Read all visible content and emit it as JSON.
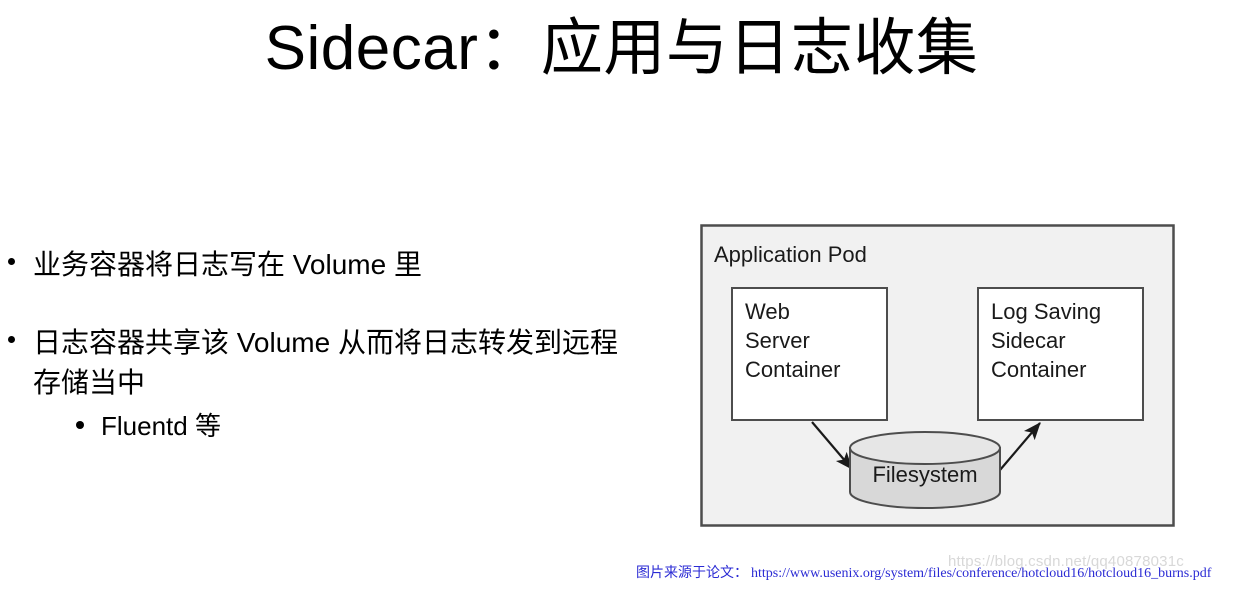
{
  "slide": {
    "title": "Sidecar：应用与日志收集",
    "bullets": [
      {
        "text": "业务容器将日志写在 Volume 里",
        "sub": []
      },
      {
        "text": "日志容器共享该 Volume 从而将日志转发到远程存储当中",
        "sub": [
          {
            "text": "Fluentd 等"
          }
        ]
      }
    ]
  },
  "diagram": {
    "pod_label": "Application Pod",
    "left_box": {
      "line1": "Web",
      "line2": "Server",
      "line3": "Container"
    },
    "right_box": {
      "line1": "Log Saving",
      "line2": "Sidecar",
      "line3": "Container"
    },
    "storage_label": "Filesystem",
    "colors": {
      "pod_fill": "#f1f1f1",
      "pod_stroke": "#4d4d4d",
      "box_fill": "#ffffff",
      "box_stroke": "#4d4d4d",
      "cylinder_fill": "#d8d8d8",
      "cylinder_stroke": "#4d4d4d",
      "arrow": "#1a1a1a"
    }
  },
  "footnote": {
    "label": "图片来源于论文：",
    "url": "https://www.usenix.org/system/files/conference/hotcloud16/hotcloud16_burns.pdf",
    "color": "#2b2bd4"
  },
  "watermark": {
    "text": "https://blog.csdn.net/qq40878031c"
  }
}
